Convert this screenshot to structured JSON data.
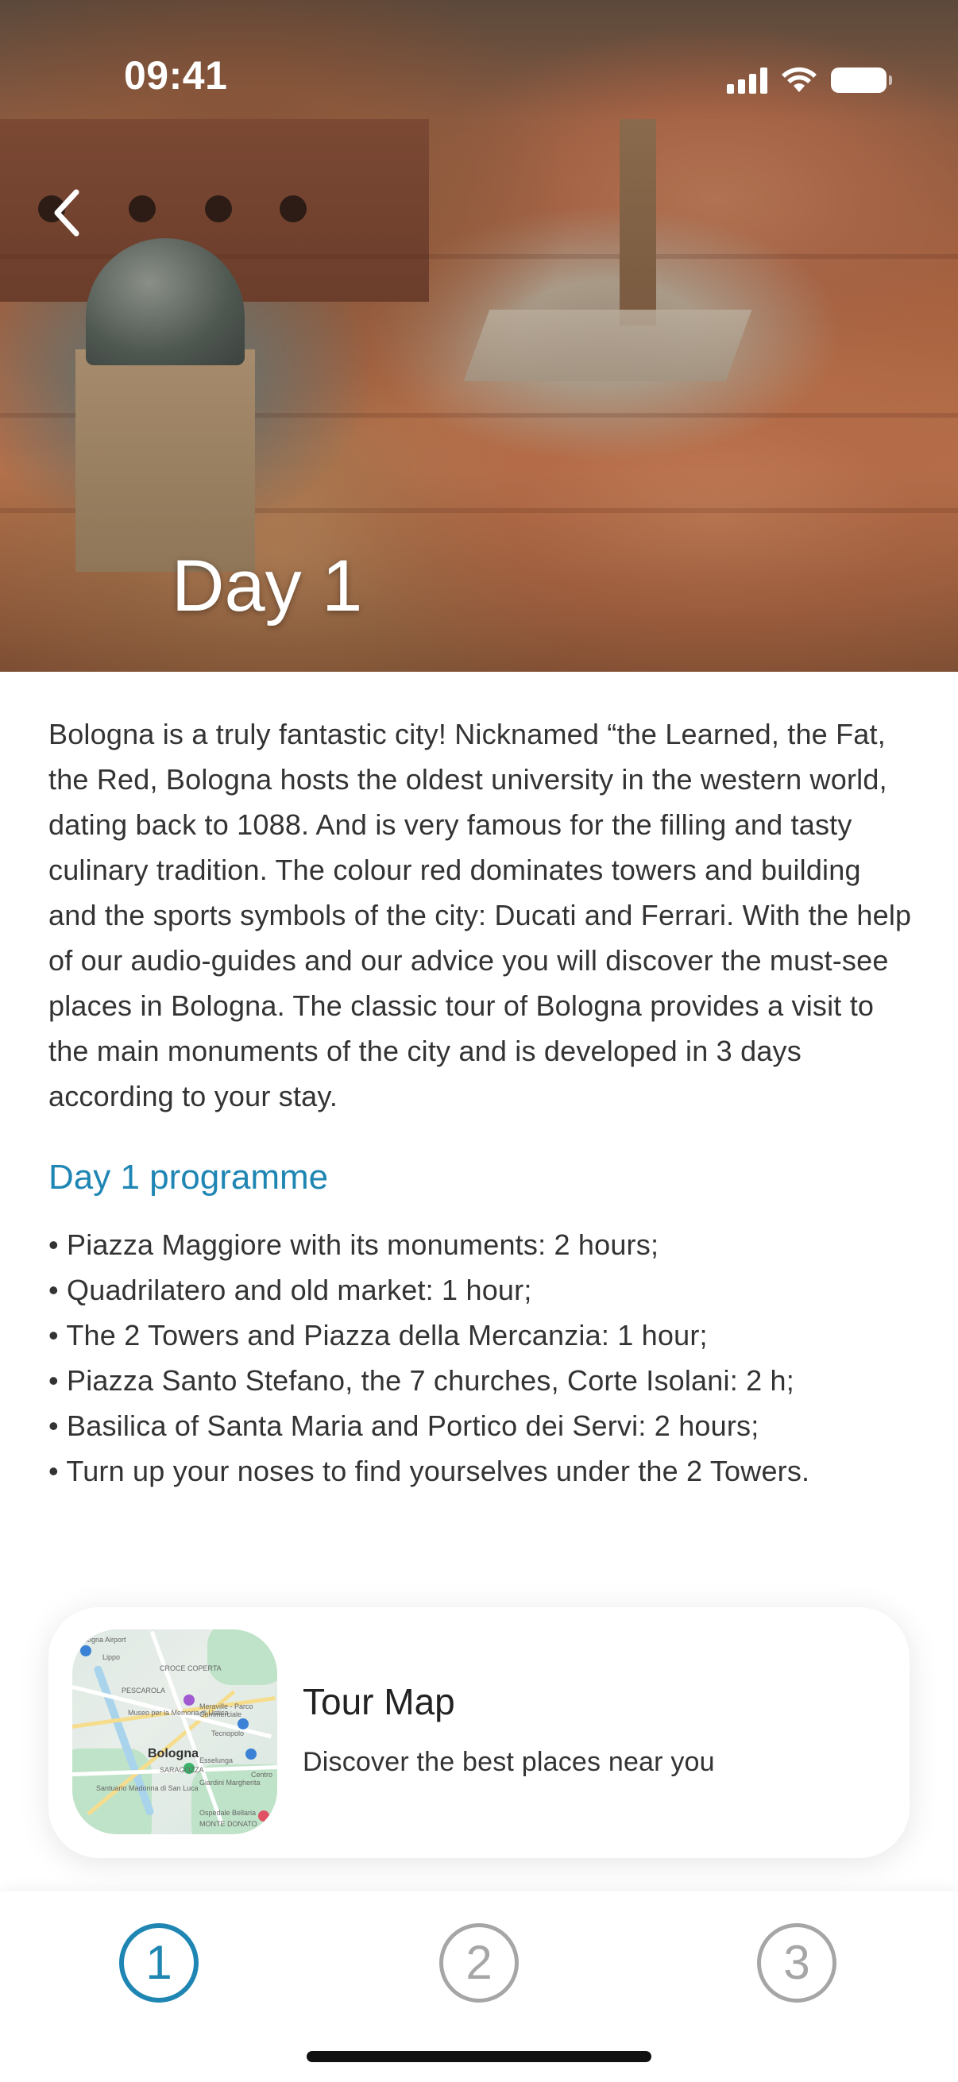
{
  "status_bar": {
    "time": "09:41"
  },
  "header": {
    "title": "Day 1",
    "back_icon": "chevron-left-icon"
  },
  "description": "Bologna is a truly fantastic city! Nicknamed “the Learned, the Fat, the Red, Bologna hosts the oldest university in the western world, dating back to 1088. And is very famous for the filling and tasty culinary tradition. The colour red dominates towers and building and the sports symbols of the city: Ducati and Ferrari. With the help of our audio-guides and our advice you will discover the must-see places in Bologna. The classic tour of Bologna provides a visit to the main monuments of the city and is developed in 3 days according to your stay.",
  "programme": {
    "title": "Day 1 programme",
    "items": [
      "Piazza Maggiore with its monuments: 2 hours;",
      "Quadrilatero and old market: 1 hour;",
      "The 2 Towers and Piazza della Mercanzia: 1 hour;",
      "Piazza Santo Stefano, the 7 churches, Corte Isolani: 2 h;",
      "Basilica of Santa Maria and Portico dei Servi: 2 hours;",
      "Turn up your noses to find yourselves under the 2 Towers."
    ]
  },
  "tour_map_card": {
    "title": "Tour Map",
    "subtitle": "Discover the best places near you",
    "map_labels": {
      "city": "Bologna",
      "district_1": "Lippo",
      "district_2": "PESCAROLA",
      "poi_1": "Museo per la Memoria di Ustica",
      "poi_2": "Meraville - Parco Commerciale",
      "poi_3": "Tecnopolo",
      "poi_4": "Esselunga",
      "poi_5": "Santuario Madonna di San Luca",
      "poi_6": "Giardini Margherita",
      "poi_7": "Ospedale Bellaria",
      "district_3": "MONTE DONATO",
      "airport": "Bologna Airport",
      "district_4": "SARAGOZZA",
      "district_5": "CROCE COPERTA",
      "district_6": "Centro"
    }
  },
  "tab_bar": {
    "tabs": [
      {
        "label": "1",
        "state": "active"
      },
      {
        "label": "2",
        "state": "inactive"
      },
      {
        "label": "3",
        "state": "inactive"
      }
    ]
  },
  "colors": {
    "accent": "#1f86b4",
    "inactive": "#a6a6a6",
    "text": "#333333"
  }
}
